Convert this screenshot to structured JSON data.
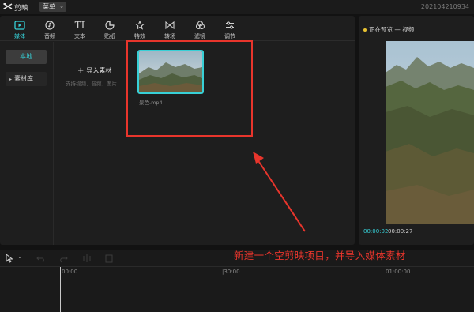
{
  "titlebar": {
    "app_name": "剪映",
    "menu_label": "菜单",
    "project_name": "202104210934"
  },
  "toolbar": {
    "tools": [
      {
        "label": "媒体",
        "icon": "media-icon",
        "active": true
      },
      {
        "label": "音频",
        "icon": "audio-icon",
        "active": false
      },
      {
        "label": "文本",
        "icon": "text-icon",
        "active": false
      },
      {
        "label": "贴纸",
        "icon": "sticker-icon",
        "active": false
      },
      {
        "label": "特效",
        "icon": "effects-icon",
        "active": false
      },
      {
        "label": "转场",
        "icon": "transition-icon",
        "active": false
      },
      {
        "label": "滤镜",
        "icon": "filter-icon",
        "active": false
      },
      {
        "label": "调节",
        "icon": "adjust-icon",
        "active": false
      }
    ]
  },
  "sidebar": {
    "local": "本地",
    "library": "素材库"
  },
  "media": {
    "import_label": "导入素材",
    "import_hint": "支持视频、音频、图片",
    "clip_name": "景色.mp4"
  },
  "preview": {
    "title": "正在预览 — 视频",
    "time_current": "00:00:02",
    "time_total": "00:00:27"
  },
  "timeline": {
    "ticks": [
      "00:00",
      "|30:00",
      "01:00:00"
    ]
  },
  "annotation": {
    "text": "新建一个空剪映项目，并导入媒体素材",
    "color": "#e8352c"
  },
  "colors": {
    "accent": "#36d1d8",
    "background": "#121212",
    "panel": "#1e1e1e"
  }
}
